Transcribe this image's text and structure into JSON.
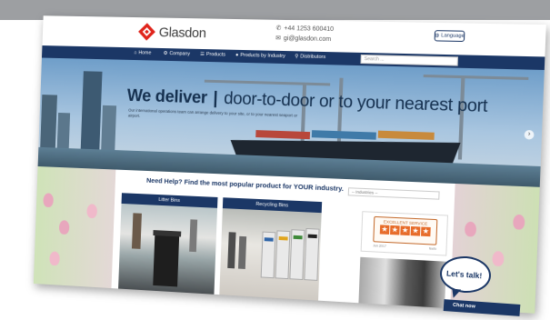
{
  "brand": {
    "name": "Glasdon",
    "color": "#e0241b"
  },
  "header": {
    "phone": "+44 1253 600410",
    "email": "gi@glasdon.com",
    "language_label": "Language"
  },
  "nav": {
    "items": [
      {
        "label": "Home",
        "icon": "home-icon"
      },
      {
        "label": "Company",
        "icon": "gear-icon"
      },
      {
        "label": "Products",
        "icon": "list-icon"
      },
      {
        "label": "Products by Industry",
        "icon": "globe-icon"
      },
      {
        "label": "Distributors",
        "icon": "map-pin-icon"
      }
    ],
    "search_placeholder": "Search ..."
  },
  "hero": {
    "title_bold": "We deliver",
    "title_rest": "door-to-door or to your nearest port",
    "subtitle": "Our international operations team can arrange delivery to your site, or to your nearest seaport or airport."
  },
  "help": {
    "title": "Need Help? Find the most popular product for YOUR industry.",
    "select_value": "-- Industries --"
  },
  "cards": [
    {
      "title": "Litter Bins"
    },
    {
      "title": "Recycling Bins"
    }
  ],
  "review": {
    "label": "EXCELLENT SERVICE",
    "stars": 5,
    "date": "Jun 2017",
    "source": "feefo"
  },
  "chat": {
    "bubble_text": "Let's talk!",
    "bar_text": "Chat now"
  },
  "colors": {
    "navy": "#1b3766",
    "accent_orange": "#e76c2a",
    "grey_band": "#9d9fa2"
  }
}
